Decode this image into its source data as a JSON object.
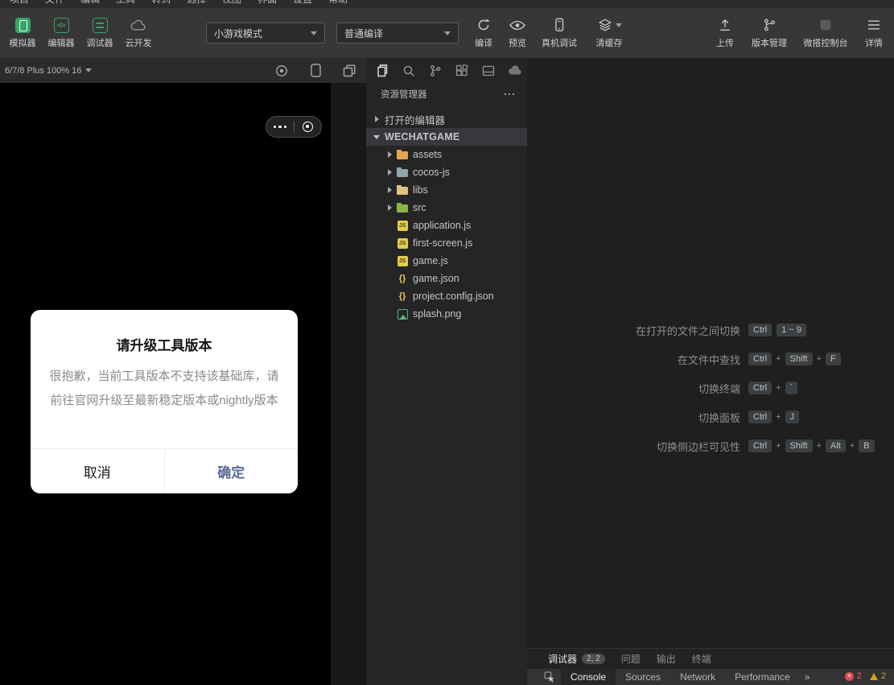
{
  "menubar": {
    "items": [
      "项目",
      "文件",
      "编辑",
      "工具",
      "转到",
      "选择",
      "视图",
      "界面",
      "设置",
      "帮助"
    ]
  },
  "toolbar": {
    "simulator": "模拟器",
    "editor": "编辑器",
    "debugger": "调试器",
    "cloud": "云开发",
    "mode_select": "小游戏模式",
    "compile_select": "普通编译",
    "compile": "编译",
    "preview": "预览",
    "device_debug": "真机调试",
    "clear_cache": "清缓存",
    "upload": "上传",
    "version": "版本管理",
    "weda": "微搭控制台",
    "details": "详情"
  },
  "simulator": {
    "device_label": "6/7/8 Plus 100% 16",
    "modal": {
      "title": "请升级工具版本",
      "body": "很抱歉，当前工具版本不支持该基础库，请前往官网升级至最新稳定版本或nightly版本",
      "cancel": "取消",
      "confirm": "确定"
    }
  },
  "explorer": {
    "title": "资源管理器",
    "open_editors": "打开的编辑器",
    "project": "WECHATGAME",
    "tree": [
      {
        "label": "assets",
        "type": "folder"
      },
      {
        "label": "cocos-js",
        "type": "folder"
      },
      {
        "label": "libs",
        "type": "folder"
      },
      {
        "label": "src",
        "type": "folder"
      },
      {
        "label": "application.js",
        "type": "js"
      },
      {
        "label": "first-screen.js",
        "type": "js"
      },
      {
        "label": "game.js",
        "type": "js"
      },
      {
        "label": "game.json",
        "type": "json"
      },
      {
        "label": "project.config.json",
        "type": "json"
      },
      {
        "label": "splash.png",
        "type": "image"
      }
    ]
  },
  "editor": {
    "shortcuts": [
      {
        "label": "在打开的文件之间切换",
        "keys": [
          "Ctrl",
          "1 ~ 9"
        ],
        "joiner": ""
      },
      {
        "label": "在文件中查找",
        "keys": [
          "Ctrl",
          "Shift",
          "F"
        ],
        "joiner": "+"
      },
      {
        "label": "切换终端",
        "keys": [
          "Ctrl",
          "`"
        ],
        "joiner": "+"
      },
      {
        "label": "切换面板",
        "keys": [
          "Ctrl",
          "J"
        ],
        "joiner": "+"
      },
      {
        "label": "切换侧边栏可见性",
        "keys": [
          "Ctrl",
          "Shift",
          "Alt",
          "B"
        ],
        "joiner": "+"
      }
    ]
  },
  "panel": {
    "tabs": {
      "debugger": "调试器",
      "badge": "2, 2",
      "problems": "问题",
      "output": "输出",
      "terminal": "终端"
    },
    "devtools": {
      "console": "Console",
      "sources": "Sources",
      "network": "Network",
      "performance": "Performance",
      "more": "»",
      "error_count": "2",
      "warning_count": "2"
    }
  }
}
